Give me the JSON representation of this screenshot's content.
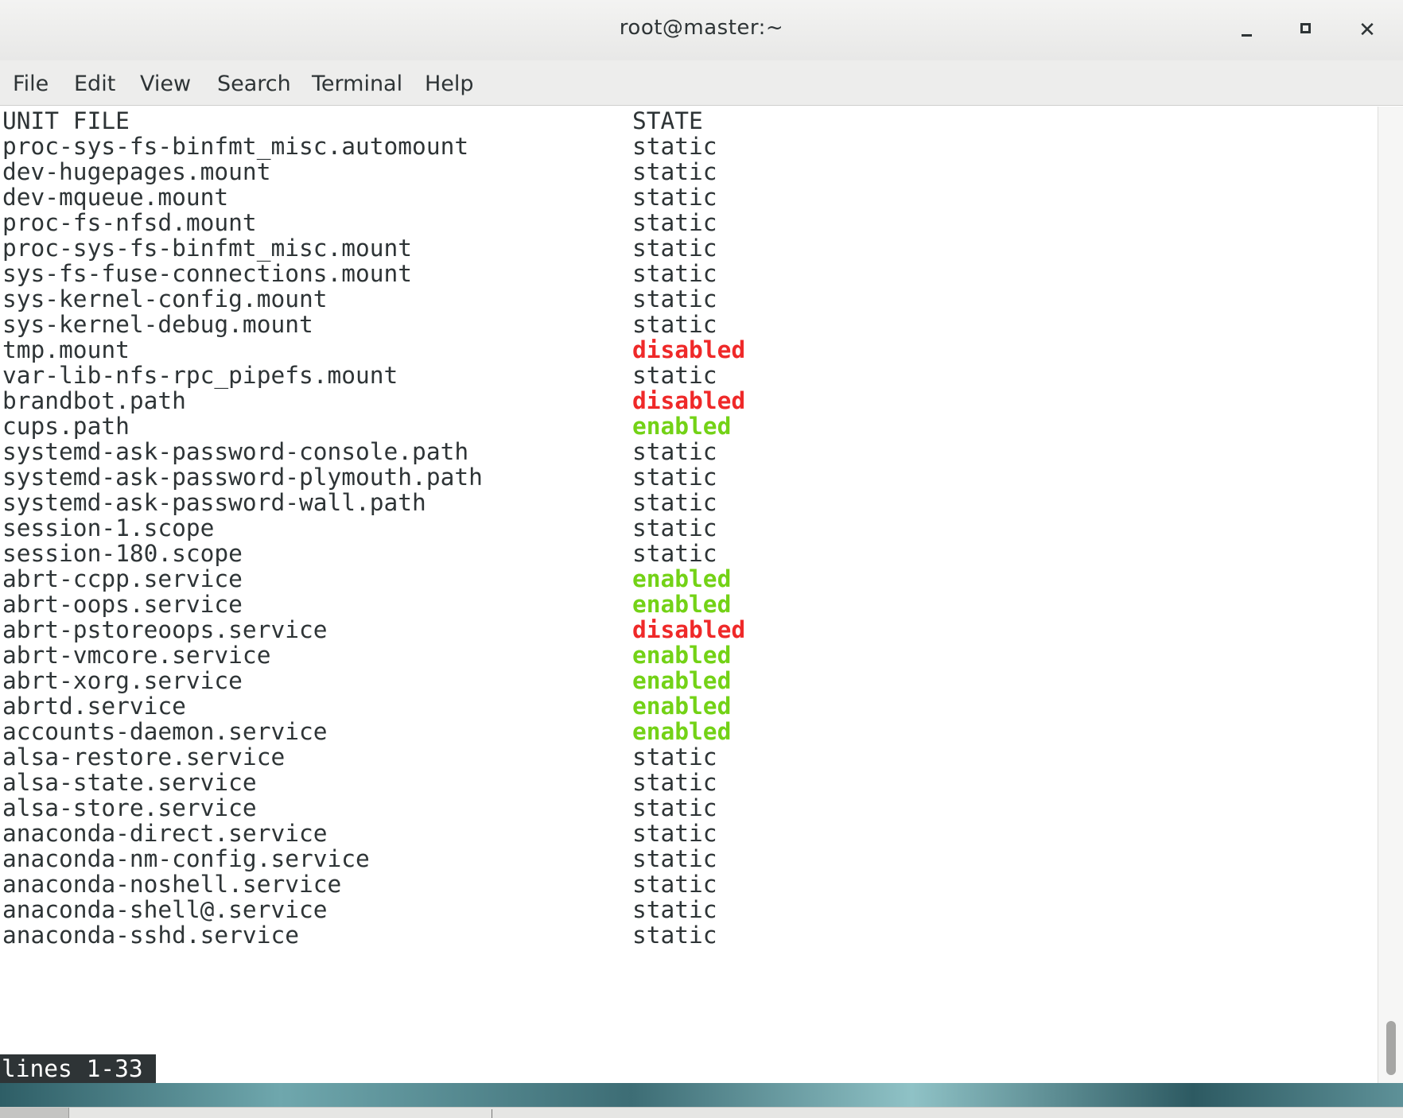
{
  "window": {
    "title": "root@master:~",
    "minimize_glyph": "",
    "maximize_glyph": "",
    "close_glyph": "✕"
  },
  "menu": {
    "file": "File",
    "edit": "Edit",
    "view": "View",
    "search": "Search",
    "terminal": "Terminal",
    "help": "Help"
  },
  "table": {
    "header": {
      "unit": "UNIT FILE",
      "state": "STATE"
    },
    "rows": [
      {
        "unit": "proc-sys-fs-binfmt_misc.automount",
        "state": "static"
      },
      {
        "unit": "dev-hugepages.mount",
        "state": "static"
      },
      {
        "unit": "dev-mqueue.mount",
        "state": "static"
      },
      {
        "unit": "proc-fs-nfsd.mount",
        "state": "static"
      },
      {
        "unit": "proc-sys-fs-binfmt_misc.mount",
        "state": "static"
      },
      {
        "unit": "sys-fs-fuse-connections.mount",
        "state": "static"
      },
      {
        "unit": "sys-kernel-config.mount",
        "state": "static"
      },
      {
        "unit": "sys-kernel-debug.mount",
        "state": "static"
      },
      {
        "unit": "tmp.mount",
        "state": "disabled"
      },
      {
        "unit": "var-lib-nfs-rpc_pipefs.mount",
        "state": "static"
      },
      {
        "unit": "brandbot.path",
        "state": "disabled"
      },
      {
        "unit": "cups.path",
        "state": "enabled"
      },
      {
        "unit": "systemd-ask-password-console.path",
        "state": "static"
      },
      {
        "unit": "systemd-ask-password-plymouth.path",
        "state": "static"
      },
      {
        "unit": "systemd-ask-password-wall.path",
        "state": "static"
      },
      {
        "unit": "session-1.scope",
        "state": "static"
      },
      {
        "unit": "session-180.scope",
        "state": "static"
      },
      {
        "unit": "abrt-ccpp.service",
        "state": "enabled"
      },
      {
        "unit": "abrt-oops.service",
        "state": "enabled"
      },
      {
        "unit": "abrt-pstoreoops.service",
        "state": "disabled"
      },
      {
        "unit": "abrt-vmcore.service",
        "state": "enabled"
      },
      {
        "unit": "abrt-xorg.service",
        "state": "enabled"
      },
      {
        "unit": "abrtd.service",
        "state": "enabled"
      },
      {
        "unit": "accounts-daemon.service",
        "state": "enabled"
      },
      {
        "unit": "alsa-restore.service",
        "state": "static"
      },
      {
        "unit": "alsa-state.service",
        "state": "static"
      },
      {
        "unit": "alsa-store.service",
        "state": "static"
      },
      {
        "unit": "anaconda-direct.service",
        "state": "static"
      },
      {
        "unit": "anaconda-nm-config.service",
        "state": "static"
      },
      {
        "unit": "anaconda-noshell.service",
        "state": "static"
      },
      {
        "unit": "anaconda-shell@.service",
        "state": "static"
      },
      {
        "unit": "anaconda-sshd.service",
        "state": "static"
      }
    ]
  },
  "pager": {
    "status": "lines 1-33"
  },
  "colors": {
    "enabled": "#73d216",
    "disabled": "#ef2929",
    "static": "#2e3436",
    "pager_bg": "#2e3436"
  },
  "icons": {
    "minimize": "minimize-icon",
    "maximize": "maximize-icon",
    "close": "close-icon"
  },
  "scroll": {
    "position_fraction": 1.0
  }
}
